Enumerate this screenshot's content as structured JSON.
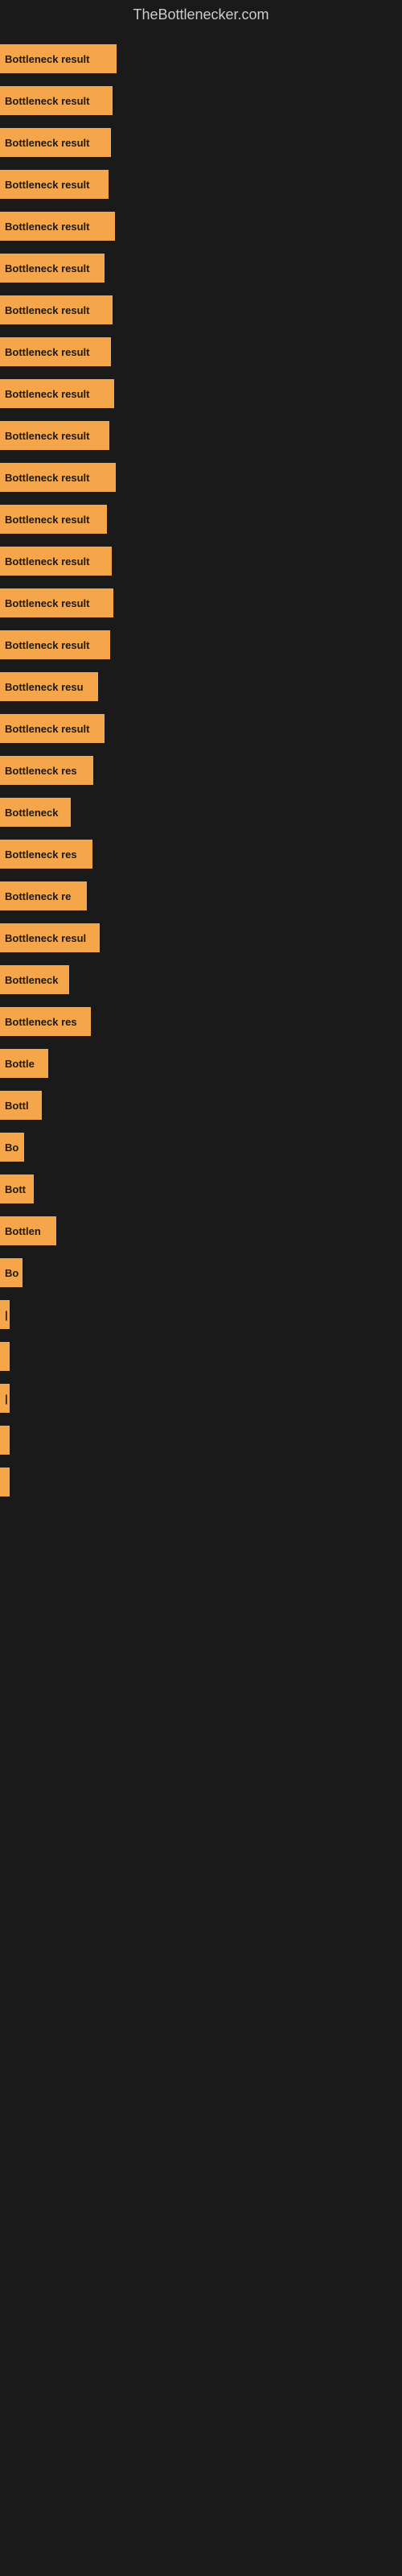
{
  "site": {
    "title": "TheBottlenecker.com"
  },
  "bars": [
    {
      "label": "Bottleneck result",
      "width": 145
    },
    {
      "label": "Bottleneck result",
      "width": 140
    },
    {
      "label": "Bottleneck result",
      "width": 138
    },
    {
      "label": "Bottleneck result",
      "width": 135
    },
    {
      "label": "Bottleneck result",
      "width": 143
    },
    {
      "label": "Bottleneck result",
      "width": 130
    },
    {
      "label": "Bottleneck result",
      "width": 140
    },
    {
      "label": "Bottleneck result",
      "width": 138
    },
    {
      "label": "Bottleneck result",
      "width": 142
    },
    {
      "label": "Bottleneck result",
      "width": 136
    },
    {
      "label": "Bottleneck result",
      "width": 144
    },
    {
      "label": "Bottleneck result",
      "width": 133
    },
    {
      "label": "Bottleneck result",
      "width": 139
    },
    {
      "label": "Bottleneck result",
      "width": 141
    },
    {
      "label": "Bottleneck result",
      "width": 137
    },
    {
      "label": "Bottleneck resu",
      "width": 122
    },
    {
      "label": "Bottleneck result",
      "width": 130
    },
    {
      "label": "Bottleneck res",
      "width": 116
    },
    {
      "label": "Bottleneck",
      "width": 88
    },
    {
      "label": "Bottleneck res",
      "width": 115
    },
    {
      "label": "Bottleneck re",
      "width": 108
    },
    {
      "label": "Bottleneck resul",
      "width": 124
    },
    {
      "label": "Bottleneck",
      "width": 86
    },
    {
      "label": "Bottleneck res",
      "width": 113
    },
    {
      "label": "Bottle",
      "width": 60
    },
    {
      "label": "Bottl",
      "width": 52
    },
    {
      "label": "Bo",
      "width": 30
    },
    {
      "label": "Bott",
      "width": 42
    },
    {
      "label": "Bottlen",
      "width": 70
    },
    {
      "label": "Bo",
      "width": 28
    },
    {
      "label": "|",
      "width": 10
    },
    {
      "label": "",
      "width": 8
    },
    {
      "label": "|",
      "width": 10
    },
    {
      "label": "",
      "width": 6
    },
    {
      "label": "",
      "width": 5
    }
  ]
}
